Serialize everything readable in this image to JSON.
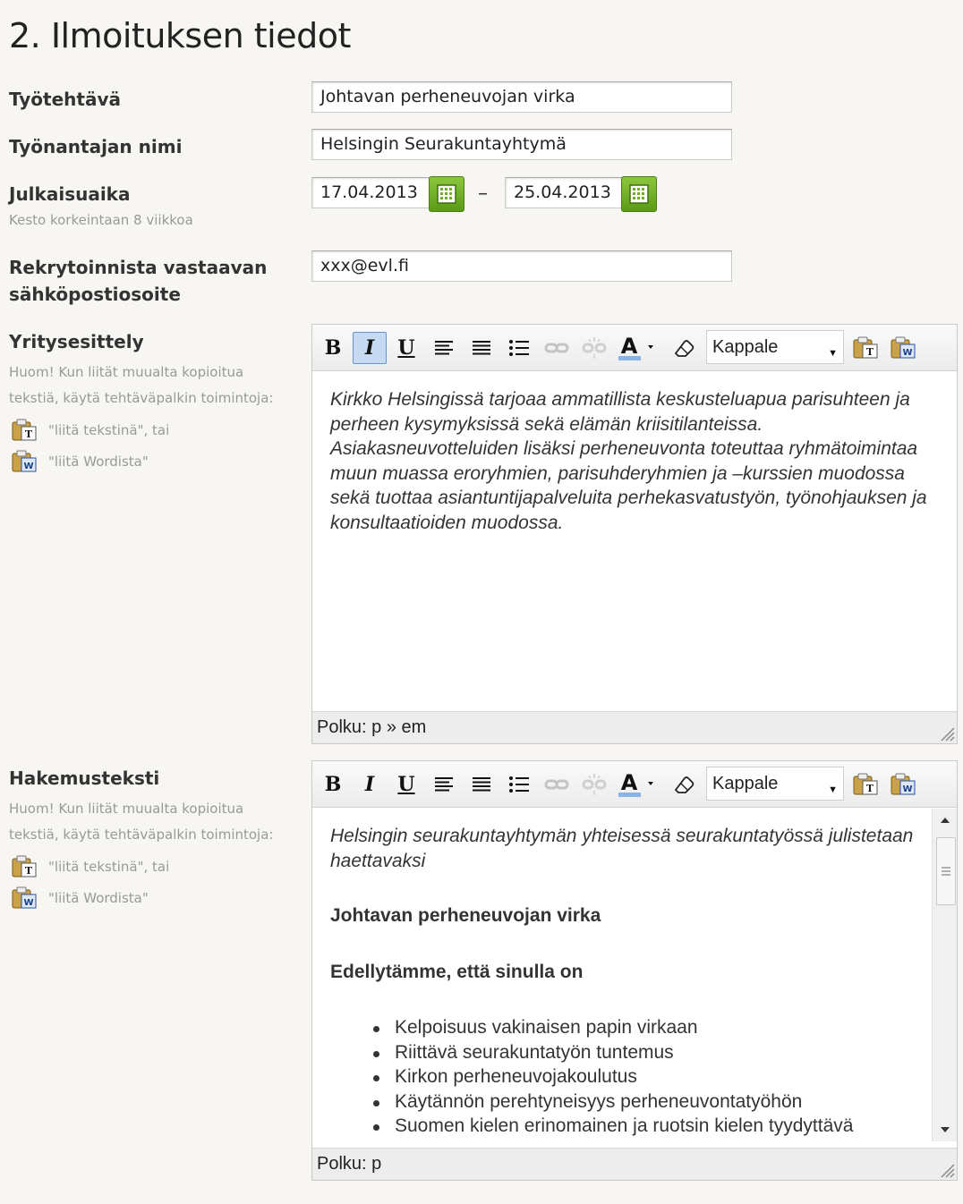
{
  "page": {
    "title": "2. Ilmoituksen tiedot"
  },
  "fields": {
    "tyotehtava": {
      "label": "Työtehtävä",
      "value": "Johtavan perheneuvojan virka"
    },
    "tyonantaja": {
      "label": "Työnantajan nimi",
      "value": "Helsingin Seurakuntayhtymä"
    },
    "julkaisuaika": {
      "label": "Julkaisuaika",
      "hint": "Kesto korkeintaan 8 viikkoa",
      "start": "17.04.2013",
      "separator": "–",
      "end": "25.04.2013"
    },
    "email": {
      "label_line1": "Rekrytoinnista vastaavan",
      "label_line2": "sähköpostiosoite",
      "value": "xxx@evl.fi"
    }
  },
  "paste_hint": {
    "line1": "Huom! Kun liität muualta kopioitua",
    "line2": "tekstiä, käytä tehtäväpalkin toimintoja:",
    "text_option": "\"liitä tekstinä\", tai",
    "word_option": "\"liitä Wordista\""
  },
  "toolbar": {
    "bold": "B",
    "italic": "I",
    "underline": "U",
    "format_value": "Kappale",
    "paste_text_icon": "T",
    "paste_word_icon": "W"
  },
  "yritysesittely": {
    "label": "Yritysesittely",
    "text": "Kirkko Helsingissä tarjoaa ammatillista keskusteluapua parisuhteen ja perheen kysymyksissä sekä elämän kriisitilanteissa. Asiakasneuvotteluiden lisäksi perheneuvonta toteuttaa ryhmätoimintaa muun muassa eroryhmien, parisuhderyhmien ja –kurssien muodossa sekä tuottaa asiantuntijapalveluita perhekasvatustyön, työnohjauksen ja konsultaatioiden muodossa.",
    "path": "Polku: p » em"
  },
  "hakemusteksti": {
    "label": "Hakemusteksti",
    "intro": "Helsingin seurakuntayhtymän yhteisessä seurakuntatyössä julistetaan haettavaksi",
    "heading": "Johtavan perheneuvojan virka",
    "subheading": "Edellytämme, että sinulla on",
    "requirements": [
      "Kelpoisuus vakinaisen papin virkaan",
      "Riittävä seurakuntatyön tuntemus",
      "Kirkon perheneuvojakoulutus",
      "Käytännön perehtyneisyys perheneuvontatyöhön",
      "Suomen kielen erinomainen ja ruotsin kielen tyydyttävä"
    ],
    "path": "Polku: p"
  },
  "colors": {
    "accent_green": "#6fad22",
    "active_button": "#c6dbf2",
    "font_color_bar": "#8ab4e6"
  }
}
